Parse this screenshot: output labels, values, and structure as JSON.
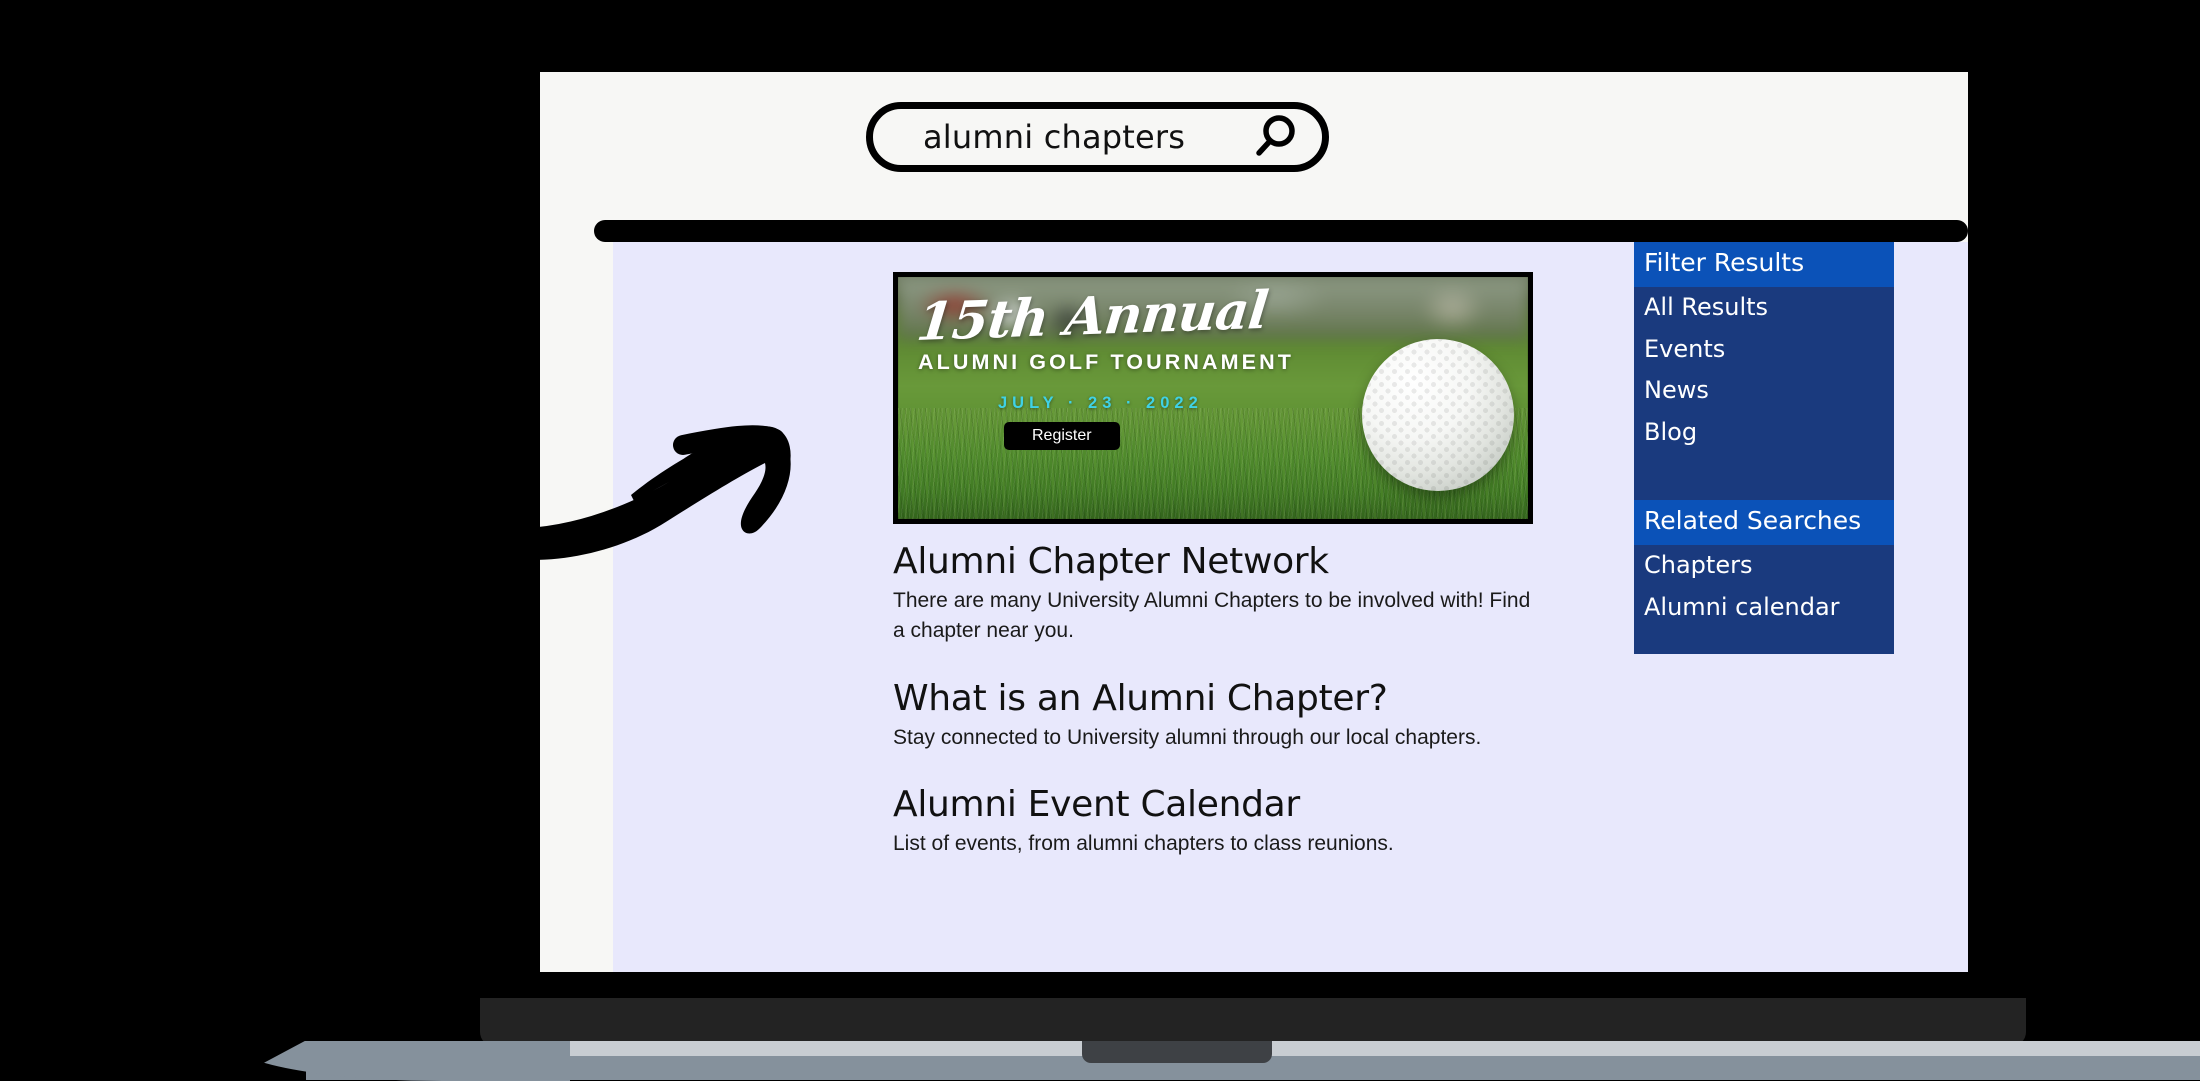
{
  "search": {
    "query": "alumni chapters",
    "placeholder": "Search",
    "icon": "search-icon"
  },
  "banner": {
    "title_script": "15th Annual",
    "subtitle": "ALUMNI GOLF TOURNAMENT",
    "date": "JULY  ·  23  ·  2022",
    "cta_label": "Register",
    "date_color": "#3FD2E6",
    "cta_bg": "#000000"
  },
  "results": [
    {
      "title": "Alumni Chapter Network",
      "description": "There are many University Alumni Chapters to be involved with! Find a chapter near you."
    },
    {
      "title": "What is an Alumni Chapter?",
      "description": "Stay connected to University alumni through our local chapters."
    },
    {
      "title": "Alumni Event Calendar",
      "description": "List of events, from alumni chapters to class reunions."
    }
  ],
  "sidebar": {
    "filter": {
      "header": "Filter Results",
      "items": [
        {
          "label": "All Results"
        },
        {
          "label": "Events"
        },
        {
          "label": "News"
        },
        {
          "label": "Blog"
        }
      ]
    },
    "related": {
      "header": "Related Searches",
      "items": [
        {
          "label": "Chapters"
        },
        {
          "label": "Alumni calendar"
        }
      ]
    },
    "colors": {
      "header_bg": "#0B52B8",
      "body_bg": "#1A3A7E",
      "text": "#FFFFFF"
    }
  },
  "annotation": {
    "arrow": "curved-arrow-pointing-to-banner"
  },
  "theme": {
    "page_bg": "#000000",
    "screen_bg": "#F7F7F5",
    "content_bg": "#E8E8FC",
    "accent": "#0B52B8"
  }
}
